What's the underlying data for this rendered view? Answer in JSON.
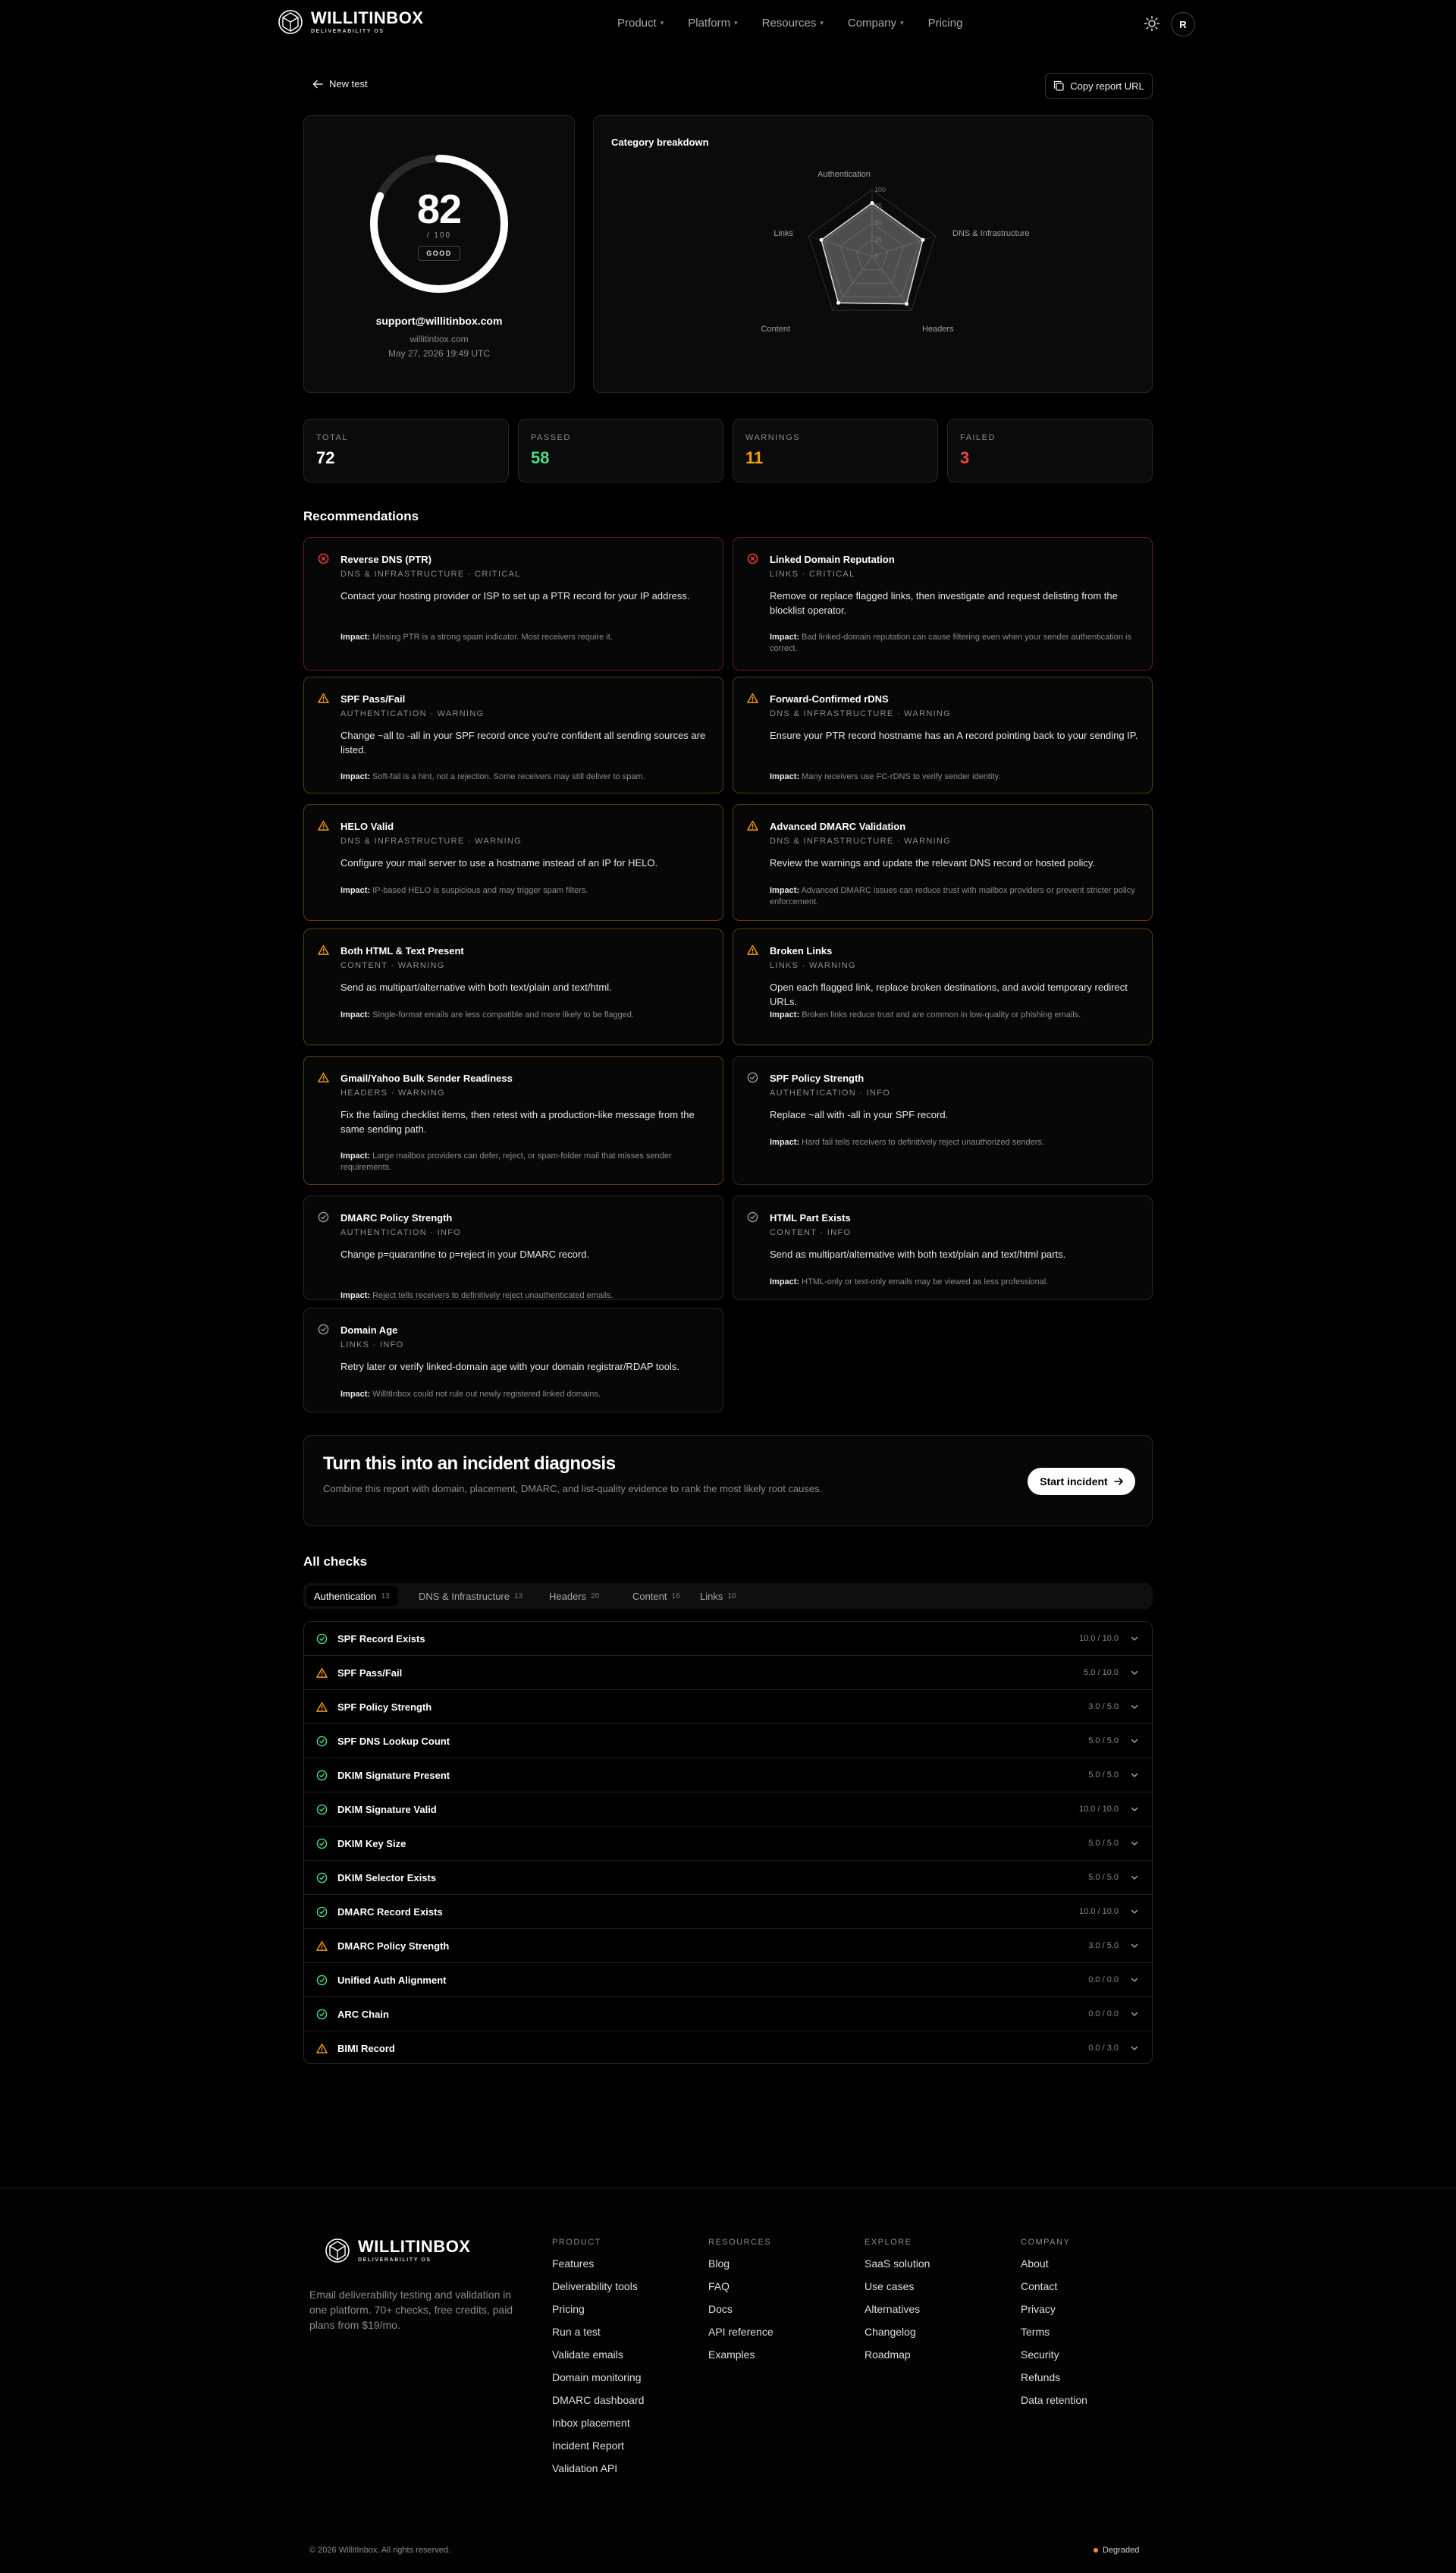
{
  "brand": {
    "name": "WILLITINBOX",
    "tagline": "DELIVERABILITY OS"
  },
  "nav": {
    "items": [
      "Product",
      "Platform",
      "Resources",
      "Company",
      "Pricing"
    ],
    "avatar": "R"
  },
  "actions": {
    "new_test": "New test",
    "copy": "Copy report URL"
  },
  "report": {
    "score": "82",
    "score_of": "/ 100",
    "score_fraction": 0.82,
    "grade": "GOOD",
    "email": "support@willitinbox.com",
    "domain": "willitinbox.com",
    "date": "May 27, 2026 19:49 UTC"
  },
  "category": {
    "title": "Category breakdown"
  },
  "chart_data": {
    "type": "radar",
    "title": "Category breakdown",
    "axes": [
      "Authentication",
      "DNS & Infrastructure",
      "Headers",
      "Content",
      "Links"
    ],
    "values": [
      80,
      80,
      88,
      86,
      80
    ],
    "ticks": [
      "0",
      "25",
      "50",
      "75",
      "100"
    ],
    "rlim": [
      0,
      100
    ]
  },
  "stats": [
    {
      "label": "TOTAL",
      "value": "72",
      "color": "#ffffff"
    },
    {
      "label": "PASSED",
      "value": "58",
      "color": "#4ade80"
    },
    {
      "label": "WARNINGS",
      "value": "11",
      "color": "#f59e0b"
    },
    {
      "label": "FAILED",
      "value": "3",
      "color": "#ef4444"
    }
  ],
  "recs_title": "Recommendations",
  "recs": [
    {
      "title": "Reverse DNS (PTR)",
      "sub": "DNS & INFRASTRUCTURE · CRITICAL",
      "level": "critical",
      "desc": "Contact your hosting provider or ISP to set up a PTR record for your IP address.",
      "impact": "Missing PTR is a strong spam indicator. Most receivers require it."
    },
    {
      "title": "Linked Domain Reputation",
      "sub": "LINKS · CRITICAL",
      "level": "critical",
      "desc": "Remove or replace flagged links, then investigate and request delisting from the blocklist operator.",
      "impact": "Bad linked-domain reputation can cause filtering even when your sender authentication is correct."
    },
    {
      "title": "SPF Pass/Fail",
      "sub": "AUTHENTICATION · WARNING",
      "level": "warning",
      "desc": "Change ~all to -all in your SPF record once you're confident all sending sources are listed.",
      "impact": "Soft-fail is a hint, not a rejection. Some receivers may still deliver to spam."
    },
    {
      "title": "Forward-Confirmed rDNS",
      "sub": "DNS & INFRASTRUCTURE · WARNING",
      "level": "warning",
      "desc": "Ensure your PTR record hostname has an A record pointing back to your sending IP.",
      "impact": "Many receivers use FC-rDNS to verify sender identity."
    },
    {
      "title": "HELO Valid",
      "sub": "DNS & INFRASTRUCTURE · WARNING",
      "level": "warning",
      "desc": "Configure your mail server to use a hostname instead of an IP for HELO.",
      "impact": "IP-based HELO is suspicious and may trigger spam filters."
    },
    {
      "title": "Advanced DMARC Validation",
      "sub": "DNS & INFRASTRUCTURE · WARNING",
      "level": "warning",
      "desc": "Review the warnings and update the relevant DNS record or hosted policy.",
      "impact": "Advanced DMARC issues can reduce trust with mailbox providers or prevent stricter policy enforcement."
    },
    {
      "title": "Both HTML & Text Present",
      "sub": "CONTENT · WARNING",
      "level": "warning",
      "desc": "Send as multipart/alternative with both text/plain and text/html.",
      "impact": "Single-format emails are less compatible and more likely to be flagged."
    },
    {
      "title": "Broken Links",
      "sub": "LINKS · WARNING",
      "level": "warning",
      "desc": "Open each flagged link, replace broken destinations, and avoid temporary redirect URLs.",
      "impact": "Broken links reduce trust and are common in low-quality or phishing emails."
    },
    {
      "title": "Gmail/Yahoo Bulk Sender Readiness",
      "sub": "HEADERS · WARNING",
      "level": "warning",
      "desc": "Fix the failing checklist items, then retest with a production-like message from the same sending path.",
      "impact": "Large mailbox providers can defer, reject, or spam-folder mail that misses sender requirements."
    },
    {
      "title": "SPF Policy Strength",
      "sub": "AUTHENTICATION · INFO",
      "level": "info",
      "desc": "Replace ~all with -all in your SPF record.",
      "impact": "Hard fail tells receivers to definitively reject unauthorized senders."
    },
    {
      "title": "DMARC Policy Strength",
      "sub": "AUTHENTICATION · INFO",
      "level": "info",
      "desc": "Change p=quarantine to p=reject in your DMARC record.",
      "impact": "Reject tells receivers to definitively reject unauthenticated emails."
    },
    {
      "title": "HTML Part Exists",
      "sub": "CONTENT · INFO",
      "level": "info",
      "desc": "Send as multipart/alternative with both text/plain and text/html parts.",
      "impact": "HTML-only or text-only emails may be viewed as less professional."
    },
    {
      "title": "Domain Age",
      "sub": "LINKS · INFO",
      "level": "info",
      "desc": "Retry later or verify linked-domain age with your domain registrar/RDAP tools.",
      "impact": "WillItInbox could not rule out newly registered linked domains."
    }
  ],
  "impact_label": "Impact:",
  "incident": {
    "title": "Turn this into an incident diagnosis",
    "desc": "Combine this report with domain, placement, DMARC, and list-quality evidence to rank the most likely root causes.",
    "button": "Start incident"
  },
  "checks_title": "All checks",
  "tabs": [
    {
      "label": "Authentication",
      "count": "13"
    },
    {
      "label": "DNS & Infrastructure",
      "count": "13"
    },
    {
      "label": "Headers",
      "count": "20"
    },
    {
      "label": "Content",
      "count": "16"
    },
    {
      "label": "Links",
      "count": "10"
    }
  ],
  "checks": [
    {
      "name": "SPF Record Exists",
      "score": "10.0 / 10.0",
      "status": "pass"
    },
    {
      "name": "SPF Pass/Fail",
      "score": "5.0 / 10.0",
      "status": "warn"
    },
    {
      "name": "SPF Policy Strength",
      "score": "3.0 / 5.0",
      "status": "warn"
    },
    {
      "name": "SPF DNS Lookup Count",
      "score": "5.0 / 5.0",
      "status": "pass"
    },
    {
      "name": "DKIM Signature Present",
      "score": "5.0 / 5.0",
      "status": "pass"
    },
    {
      "name": "DKIM Signature Valid",
      "score": "10.0 / 10.0",
      "status": "pass"
    },
    {
      "name": "DKIM Key Size",
      "score": "5.0 / 5.0",
      "status": "pass"
    },
    {
      "name": "DKIM Selector Exists",
      "score": "5.0 / 5.0",
      "status": "pass"
    },
    {
      "name": "DMARC Record Exists",
      "score": "10.0 / 10.0",
      "status": "pass"
    },
    {
      "name": "DMARC Policy Strength",
      "score": "3.0 / 5.0",
      "status": "warn"
    },
    {
      "name": "Unified Auth Alignment",
      "score": "0.0 / 0.0",
      "status": "pass"
    },
    {
      "name": "ARC Chain",
      "score": "0.0 / 0.0",
      "status": "pass"
    },
    {
      "name": "BIMI Record",
      "score": "0.0 / 3.0",
      "status": "warn"
    }
  ],
  "footer": {
    "tagline": "Email deliverability testing and validation in one platform. 70+ checks, free credits, paid plans from $19/mo.",
    "columns": [
      {
        "title": "PRODUCT",
        "links": [
          "Features",
          "Deliverability tools",
          "Pricing",
          "Run a test",
          "Validate emails",
          "Domain monitoring",
          "DMARC dashboard",
          "Inbox placement",
          "Incident Report",
          "Validation API"
        ]
      },
      {
        "title": "RESOURCES",
        "links": [
          "Blog",
          "FAQ",
          "Docs",
          "API reference",
          "Examples"
        ]
      },
      {
        "title": "EXPLORE",
        "links": [
          "SaaS solution",
          "Use cases",
          "Alternatives",
          "Changelog",
          "Roadmap"
        ]
      },
      {
        "title": "COMPANY",
        "links": [
          "About",
          "Contact",
          "Privacy",
          "Terms",
          "Security",
          "Refunds",
          "Data retention"
        ]
      }
    ],
    "copyright": "© 2026 WillItInbox. All rights reserved.",
    "status": "Degraded"
  },
  "colors": {
    "critical": "#ef4444",
    "warning": "#f59e0b",
    "pass": "#4ade80",
    "info": "#9a9a9a",
    "status": "#f08a3c"
  }
}
